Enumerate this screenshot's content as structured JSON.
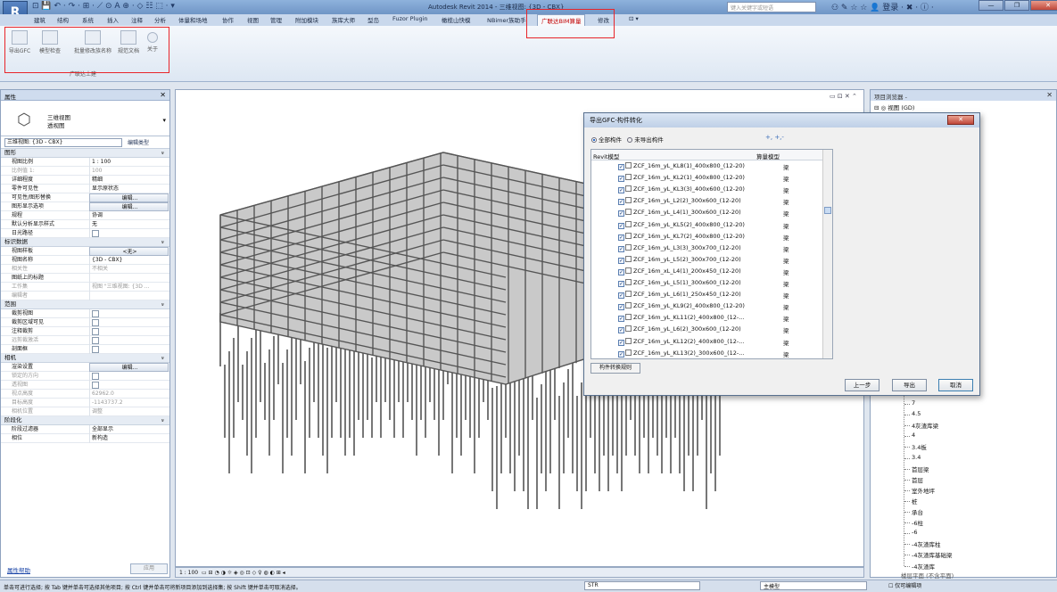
{
  "app": {
    "title": "Autodesk Revit 2014 -   三维视图: {3D - CBX}",
    "search_placeholder": "键入关键字或短语",
    "login": "登录",
    "quick_access": "⊡ 💾 ↶ · ↷ · ⊞ · ⟋ ⊙ A ⊕ · ◇ ☷ ⬚ · ▾"
  },
  "menu_tabs": [
    "建筑",
    "结构",
    "系统",
    "插入",
    "注释",
    "分析",
    "体量和场地",
    "协作",
    "视图",
    "管理",
    "附加模块",
    "族库大师",
    "型岛",
    "Fuzor Plugin",
    "橄榄山快模",
    "NBimer族助手",
    "广联达BIM算量",
    "修改"
  ],
  "ribbon": {
    "buttons": [
      "导出GFC",
      "模型检查",
      "批量修改族名称",
      "规范文档",
      "关于"
    ],
    "panel_label": "广联达土建"
  },
  "properties": {
    "header": "属性",
    "type_line1": "三维视图",
    "type_line2": "透视图",
    "view_selector": "三维视图: {3D - CBX}",
    "edit_type": "编辑类型",
    "rows": [
      {
        "kind": "sect",
        "k": "图形"
      },
      {
        "k": "视图比例",
        "v": "1 : 100"
      },
      {
        "k": "比例值 1:",
        "v": "100",
        "grey": true
      },
      {
        "k": "详细程度",
        "v": "精细"
      },
      {
        "k": "零件可见性",
        "v": "显示原状态"
      },
      {
        "k": "可见性/图形替换",
        "v": "编辑...",
        "btn": true
      },
      {
        "k": "图形显示选项",
        "v": "编辑...",
        "btn": true
      },
      {
        "k": "规程",
        "v": "协调"
      },
      {
        "k": "默认分析显示样式",
        "v": "无"
      },
      {
        "k": "日光路径",
        "chk": true
      },
      {
        "kind": "sect",
        "k": "标识数据"
      },
      {
        "k": "视图样板",
        "v": "<无>",
        "btn": true
      },
      {
        "k": "视图名称",
        "v": "{3D - CBX}"
      },
      {
        "k": "相关性",
        "v": "不相关",
        "grey": true
      },
      {
        "k": "图纸上的标题",
        "v": ""
      },
      {
        "k": "工作集",
        "v": "视图 \"三维视图: {3D ...",
        "grey": true
      },
      {
        "k": "编辑者",
        "v": "",
        "grey": true
      },
      {
        "kind": "sect",
        "k": "范围"
      },
      {
        "k": "裁剪视图",
        "chk": true
      },
      {
        "k": "裁剪区域可见",
        "chk": true
      },
      {
        "k": "注释裁剪",
        "chk": true
      },
      {
        "k": "远剪裁激活",
        "chk": true,
        "grey": true
      },
      {
        "k": "剖面框",
        "chk": true
      },
      {
        "kind": "sect",
        "k": "相机"
      },
      {
        "k": "渲染设置",
        "v": "编辑...",
        "btn": true
      },
      {
        "k": "锁定的方向",
        "chk": true,
        "grey": true
      },
      {
        "k": "透视图",
        "chk": true,
        "grey": true
      },
      {
        "k": "视点高度",
        "v": "62962.0",
        "grey": true
      },
      {
        "k": "目标高度",
        "v": "-1143737.2",
        "grey": true
      },
      {
        "k": "相机位置",
        "v": "调整",
        "grey": true
      },
      {
        "kind": "sect",
        "k": "阶段化"
      },
      {
        "k": "阶段过滤器",
        "v": "全部显示"
      },
      {
        "k": "相位",
        "v": "新构造"
      }
    ],
    "help": "属性帮助",
    "apply": "应用"
  },
  "viewport": {
    "scale": "1 : 100",
    "bar_icons": "▭ ⊟ ◔ ◑ ☼ ◈ ◎ ⊡ ◇ ♀ ◍ ◐ ⊞ ◂"
  },
  "browser": {
    "header": "项目浏览器 -",
    "root": "⊟ ◎ 视图 (GD)",
    "levels": [
      "7",
      "4.5",
      "4灰渣库梁",
      "4",
      "3.4板",
      "3.4",
      "首层梁",
      "首层",
      "室外地坪",
      "桩",
      "承台",
      "-6柱",
      "-6",
      "-4灰渣库柱",
      "-4灰渣库基础梁",
      "-4灰渣库"
    ],
    "tail": "楼层平面 (不含平面)"
  },
  "dialog": {
    "title": "导出GFC-构件转化",
    "radio_all": "全部构件",
    "radio_unexported": "未导出构件",
    "expand_buttons": "+,  +,-",
    "col_revit": "Revit模型",
    "col_calc": "算量模型",
    "items": [
      "ZCF_16m_yL_KL8(1)_400x800_(12-20)",
      "ZCF_16m_yL_KL2(1)_400x800_(12-20)",
      "ZCF_16m_yL_KL3(3)_400x600_(12-20)",
      "ZCF_16m_yL_L2(2)_300x600_(12-20)",
      "ZCF_16m_yL_L4(1)_300x600_(12-20)",
      "ZCF_16m_yL_KL5(2)_400x800_(12-20)",
      "ZCF_16m_yL_KL7(2)_400x800_(12-20)",
      "ZCF_16m_yL_L3(3)_300x700_(12-20)",
      "ZCF_16m_yL_L5(2)_300x700_(12-20)",
      "ZCF_16m_xL_L4(1)_200x450_(12-20)",
      "ZCF_16m_yL_L5(1)_300x600_(12-20)",
      "ZCF_16m_yL_L6(1)_250x450_(12-20)",
      "ZCF_16m_yL_KL9(2)_400x800_(12-20)",
      "ZCF_16m_yL_KL11(2)_400x800_(12-...",
      "ZCF_16m_yL_L6(2)_300x600_(12-20)",
      "ZCF_16m_yL_KL12(2)_400x800_(12-...",
      "ZCF_16m_yL_KL13(2)_300x600_(12-..."
    ],
    "category": "梁",
    "rule_button": "构件转换规则",
    "prev": "上一步",
    "export": "导出",
    "cancel": "取消"
  },
  "status": {
    "hint": "单击可进行选择; 按 Tab 键并单击可选择其他项目; 按 Ctrl 键并单击可将新项目添加到选择集; 按 Shift 键并单击可取消选择。",
    "model": "STR",
    "main": "主模型",
    "editable": "仅可编辑项"
  }
}
